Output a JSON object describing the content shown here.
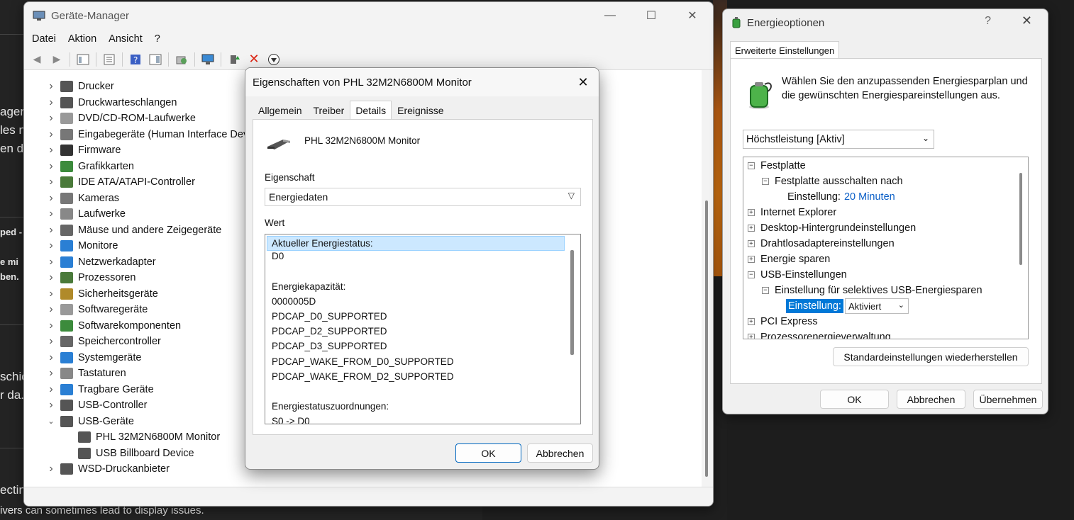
{
  "background": {
    "left_fragments": [
      "ager",
      "les n",
      "en d",
      "ped -",
      "e mi",
      "ben.",
      "schic",
      "r da.",
      "ectin"
    ],
    "bottom_text": "ivers can sometimes lead to display issues."
  },
  "device_manager": {
    "title": "Geräte-Manager",
    "window_buttons": {
      "minimize": "—",
      "maximize": "☐",
      "close": "✕"
    },
    "menu": [
      "Datei",
      "Aktion",
      "Ansicht",
      "?"
    ],
    "tree": [
      {
        "label": "Drucker",
        "expanded": false,
        "icon": "printer-icon",
        "color": "#555"
      },
      {
        "label": "Druckwarteschlangen",
        "expanded": false,
        "icon": "print-queue-icon",
        "color": "#555"
      },
      {
        "label": "DVD/CD-ROM-Laufwerke",
        "expanded": false,
        "icon": "disc-drive-icon",
        "color": "#999"
      },
      {
        "label": "Eingabegeräte (Human Interface Dev",
        "expanded": false,
        "icon": "hid-icon",
        "color": "#777"
      },
      {
        "label": "Firmware",
        "expanded": false,
        "icon": "firmware-icon",
        "color": "#333"
      },
      {
        "label": "Grafikkarten",
        "expanded": false,
        "icon": "display-adapter-icon",
        "color": "#3c8b3c"
      },
      {
        "label": "IDE ATA/ATAPI-Controller",
        "expanded": false,
        "icon": "ide-controller-icon",
        "color": "#4a7a3a"
      },
      {
        "label": "Kameras",
        "expanded": false,
        "icon": "camera-icon",
        "color": "#777"
      },
      {
        "label": "Laufwerke",
        "expanded": false,
        "icon": "disk-drive-icon",
        "color": "#888"
      },
      {
        "label": "Mäuse und andere Zeigegeräte",
        "expanded": false,
        "icon": "mouse-icon",
        "color": "#666"
      },
      {
        "label": "Monitore",
        "expanded": false,
        "icon": "monitor-icon",
        "color": "#2a7fd4"
      },
      {
        "label": "Netzwerkadapter",
        "expanded": false,
        "icon": "network-adapter-icon",
        "color": "#2a7fd4"
      },
      {
        "label": "Prozessoren",
        "expanded": false,
        "icon": "processor-icon",
        "color": "#4a7a3a"
      },
      {
        "label": "Sicherheitsgeräte",
        "expanded": false,
        "icon": "security-device-icon",
        "color": "#b08a2a"
      },
      {
        "label": "Softwaregeräte",
        "expanded": false,
        "icon": "software-device-icon",
        "color": "#999"
      },
      {
        "label": "Softwarekomponenten",
        "expanded": false,
        "icon": "software-component-icon",
        "color": "#3c8b3c"
      },
      {
        "label": "Speichercontroller",
        "expanded": false,
        "icon": "storage-controller-icon",
        "color": "#666"
      },
      {
        "label": "Systemgeräte",
        "expanded": false,
        "icon": "system-device-icon",
        "color": "#2a7fd4"
      },
      {
        "label": "Tastaturen",
        "expanded": false,
        "icon": "keyboard-icon",
        "color": "#888"
      },
      {
        "label": "Tragbare Geräte",
        "expanded": false,
        "icon": "portable-device-icon",
        "color": "#2a7fd4"
      },
      {
        "label": "USB-Controller",
        "expanded": false,
        "icon": "usb-controller-icon",
        "color": "#555"
      },
      {
        "label": "USB-Geräte",
        "expanded": true,
        "icon": "usb-device-icon",
        "color": "#555"
      },
      {
        "label": "PHL 32M2N6800M Monitor",
        "child": true,
        "icon": "usb-device-icon",
        "color": "#555"
      },
      {
        "label": "USB Billboard Device",
        "child": true,
        "icon": "usb-device-icon",
        "color": "#555"
      },
      {
        "label": "WSD-Druckanbieter",
        "expanded": false,
        "icon": "wsd-printer-icon",
        "color": "#555"
      }
    ]
  },
  "properties_dialog": {
    "title": "Eigenschaften von PHL 32M2N6800M Monitor",
    "tabs": [
      "Allgemein",
      "Treiber",
      "Details",
      "Ereignisse"
    ],
    "active_tab": "Details",
    "device_name": "PHL 32M2N6800M Monitor",
    "property_label": "Eigenschaft",
    "property_value": "Energiedaten",
    "value_label": "Wert",
    "values": [
      "Aktueller Energiestatus:",
      "D0",
      "",
      "Energiekapazität:",
      "0000005D",
      "PDCAP_D0_SUPPORTED",
      "PDCAP_D2_SUPPORTED",
      "PDCAP_D3_SUPPORTED",
      "PDCAP_WAKE_FROM_D0_SUPPORTED",
      "PDCAP_WAKE_FROM_D2_SUPPORTED",
      "",
      "Energiestatuszuordnungen:",
      "S0 -> D0"
    ],
    "ok": "OK",
    "cancel": "Abbrechen"
  },
  "power_options": {
    "title": "Energieoptionen",
    "help": "?",
    "close": "✕",
    "tab": "Erweiterte Einstellungen",
    "description": "Wählen Sie den anzupassenden Energiesparplan und die gewünschten Energiespareinstellungen aus.",
    "plan": "Höchstleistung [Aktiv]",
    "tree": {
      "festplatte": "Festplatte",
      "festplatte_aus": "Festplatte ausschalten nach",
      "einstellung_label": "Einstellung:",
      "einstellung_value": "20 Minuten",
      "ie": "Internet Explorer",
      "desktop": "Desktop-Hintergrundeinstellungen",
      "drahtlos": "Drahtlosadaptereinstellungen",
      "energie": "Energie sparen",
      "usb": "USB-Einstellungen",
      "usb_selective": "Einstellung für selektives USB-Energiesparen",
      "usb_einstellung_label": "Einstellung:",
      "usb_einstellung_value": "Aktiviert",
      "pci": "PCI Express",
      "prozessor": "Prozessorenergieverwaltung"
    },
    "restore": "Standardeinstellungen wiederherstellen",
    "ok": "OK",
    "cancel": "Abbrechen",
    "apply": "Übernehmen"
  }
}
